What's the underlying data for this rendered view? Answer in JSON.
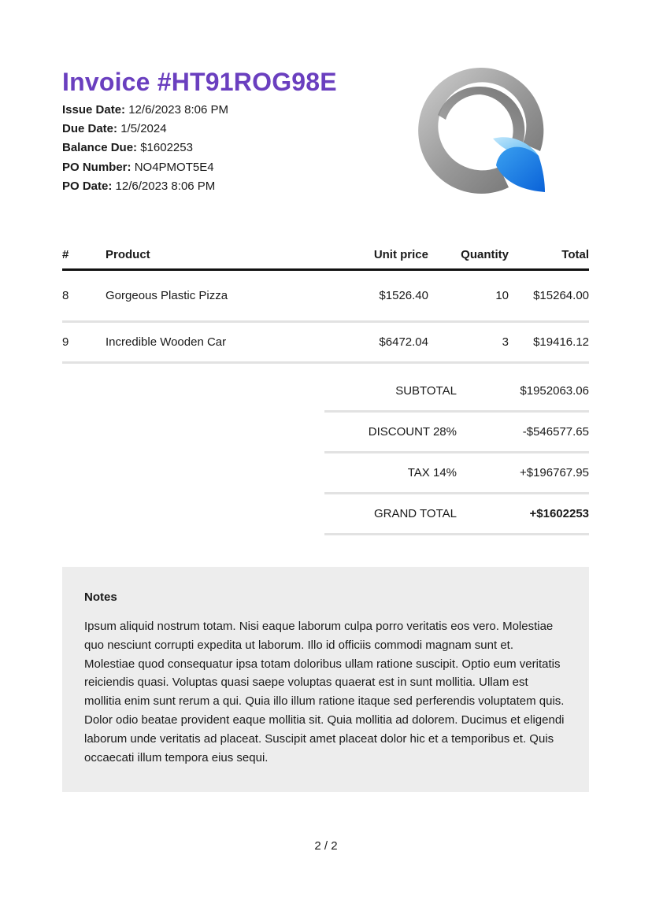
{
  "invoice": {
    "title": "Invoice #HT91ROG98E",
    "meta": [
      {
        "label": "Issue Date:",
        "value": "12/6/2023 8:06 PM"
      },
      {
        "label": "Due Date:",
        "value": "1/5/2024"
      },
      {
        "label": "Balance Due:",
        "value": "$1602253"
      },
      {
        "label": "PO Number:",
        "value": "NO4PMOT5E4"
      },
      {
        "label": "PO Date:",
        "value": "12/6/2023 8:06 PM"
      }
    ]
  },
  "logo": {
    "icon": "q-leaf-logo",
    "colors": {
      "gray": "#8a8a8a",
      "blue": "#1a7fe6",
      "light_blue": "#6cc2f5"
    }
  },
  "table": {
    "headers": {
      "num": "#",
      "product": "Product",
      "unit_price": "Unit price",
      "quantity": "Quantity",
      "total": "Total"
    },
    "rows": [
      {
        "num": "8",
        "product": "Gorgeous Plastic Pizza",
        "unit_price": "$1526.40",
        "quantity": "10",
        "total": "$15264.00"
      },
      {
        "num": "9",
        "product": "Incredible Wooden Car",
        "unit_price": "$6472.04",
        "quantity": "3",
        "total": "$19416.12"
      }
    ]
  },
  "totals": [
    {
      "label": "SUBTOTAL",
      "value": "$1952063.06"
    },
    {
      "label": "DISCOUNT 28%",
      "value": "-$546577.65"
    },
    {
      "label": "TAX 14%",
      "value": "+$196767.95"
    },
    {
      "label": "GRAND TOTAL",
      "value": "+$1602253"
    }
  ],
  "notes": {
    "title": "Notes",
    "body": "Ipsum aliquid nostrum totam. Nisi eaque laborum culpa porro veritatis eos vero. Molestiae quo nesciunt corrupti expedita ut laborum. Illo id officiis commodi magnam sunt et. Molestiae quod consequatur ipsa totam doloribus ullam ratione suscipit. Optio eum veritatis reiciendis quasi. Voluptas quasi saepe voluptas quaerat est in sunt mollitia. Ullam est mollitia enim sunt rerum a qui. Quia illo illum ratione itaque sed perferendis voluptatem quis. Dolor odio beatae provident eaque mollitia sit. Quia mollitia ad dolorem. Ducimus et eligendi laborum unde veritatis ad placeat. Suscipit amet placeat dolor hic et a temporibus et. Quis occaecati illum tempora eius sequi."
  },
  "page": {
    "number": "2 / 2"
  }
}
